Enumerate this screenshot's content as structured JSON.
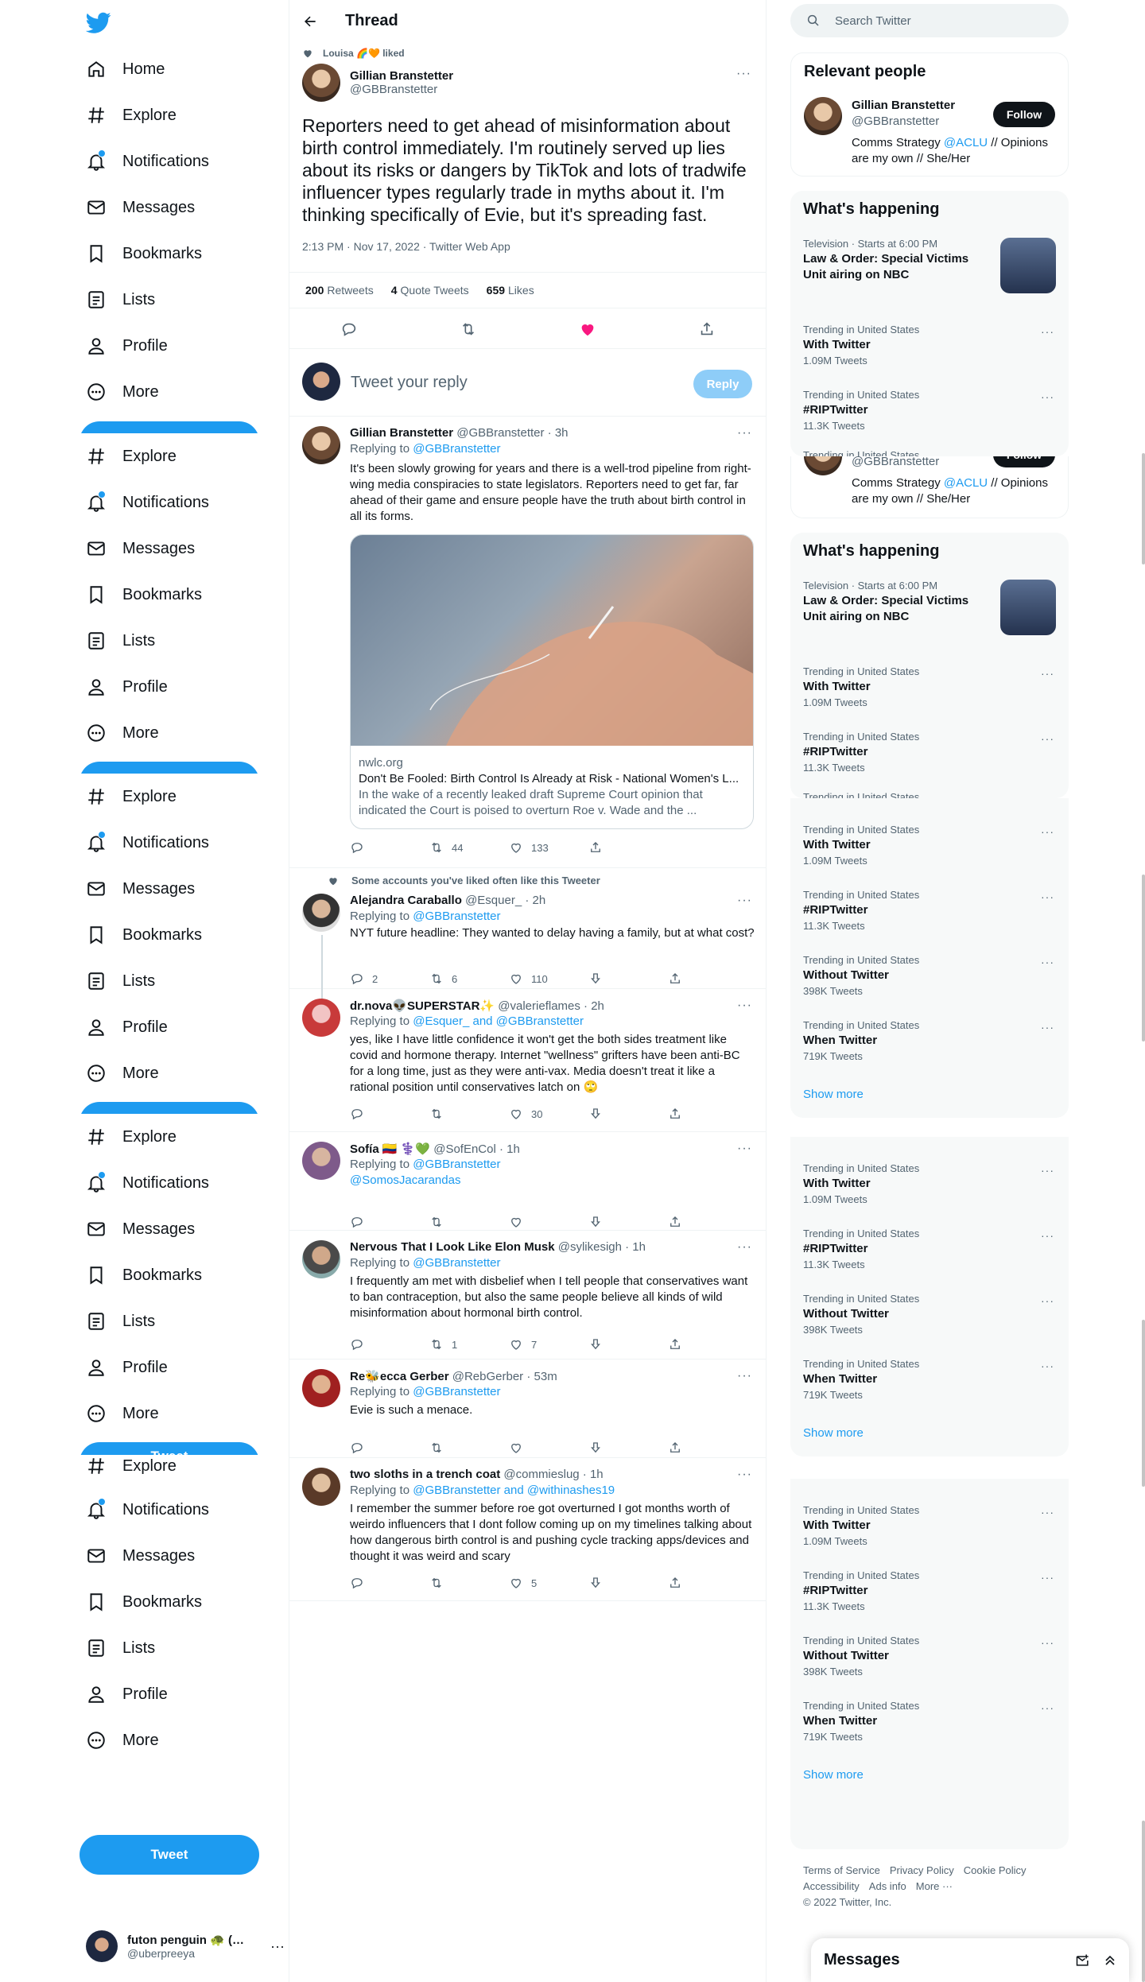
{
  "nav": {
    "items": [
      {
        "label": "Home"
      },
      {
        "label": "Explore"
      },
      {
        "label": "Notifications"
      },
      {
        "label": "Messages"
      },
      {
        "label": "Bookmarks"
      },
      {
        "label": "Lists"
      },
      {
        "label": "Profile"
      },
      {
        "label": "More"
      }
    ],
    "tweet_label": "Tweet",
    "account": {
      "name": "futon penguin 🐢 (…",
      "handle": "@uberpreeya"
    }
  },
  "thread": {
    "title": "Thread",
    "liked_by": "Louisa 🌈🧡 liked",
    "author": {
      "name": "Gillian Branstetter",
      "handle": "@GBBranstetter"
    },
    "text": "Reporters need to get ahead of misinformation about birth control immediately. I'm routinely served up lies about its risks or dangers by TikTok and lots of tradwife influencer types regularly trade in myths about it. I'm thinking specifically of Evie, but it's spreading fast.",
    "meta": "2:13 PM · Nov 17, 2022 · Twitter Web App",
    "stats": {
      "retweets": "200",
      "retweets_label": "Retweets",
      "quotes": "4",
      "quotes_label": "Quote Tweets",
      "likes": "659",
      "likes_label": "Likes"
    },
    "reply_placeholder": "Tweet your reply",
    "reply_button": "Reply"
  },
  "replies": [
    {
      "name": "Gillian Branstetter",
      "handle": "@GBBranstetter · 3h",
      "replying": "Replying to",
      "to": "@GBBranstetter",
      "text": "It's been slowly growing for years and there is a well-trod pipeline from right-wing media conspiracies to state legislators. Reporters need to get far, far ahead of their game and ensure people have the truth about birth control in all its forms.",
      "card": {
        "domain": "nwlc.org",
        "title": "Don't Be Fooled: Birth Control Is Already at Risk - National Women's L...",
        "desc": "In the wake of a recently leaked draft Supreme Court opinion that indicated the Court is poised to overturn Roe v. Wade and the ..."
      },
      "retweets": "44",
      "likes": "133"
    },
    {
      "context": "Some accounts you've liked often like this Tweeter",
      "name": "Alejandra Caraballo",
      "handle": "@Esquer_ · 2h",
      "replying": "Replying to",
      "to": "@GBBranstetter",
      "text": "NYT future headline: They wanted to delay having a family, but at what cost?",
      "replies": "2",
      "retweets": "6",
      "likes": "110"
    },
    {
      "name": "dr.nova👽SUPERSTAR✨",
      "handle": "@valerieflames · 2h",
      "replying": "Replying to",
      "to": "@Esquer_ and @GBBranstetter",
      "text": "yes, like I have little confidence it won't get the both sides treatment like covid and hormone therapy. Internet \"wellness\" grifters have been anti-BC for a long time, just as they were anti-vax. Media doesn't treat it like a rational position until conservatives latch on 🙄",
      "likes": "30"
    },
    {
      "name": "Sofía 🇨🇴 ⚕️💚",
      "handle": "@SofEnCol · 1h",
      "replying": "Replying to",
      "to": "@GBBranstetter",
      "to2": "@SomosJacarandas"
    },
    {
      "name": "Nervous That I Look Like Elon Musk",
      "handle": "@sylikesigh · 1h",
      "replying": "Replying to",
      "to": "@GBBranstetter",
      "text": "I frequently am met with disbelief when I tell people that conservatives want to ban contraception, but also the same people believe all kinds of wild misinformation about hormonal birth control.",
      "retweets": "1",
      "likes": "7"
    },
    {
      "name": "Re🐝ecca Gerber",
      "handle": "@RebGerber · 53m",
      "replying": "Replying to",
      "to": "@GBBranstetter",
      "text": "Evie is such a menace."
    },
    {
      "name": "two sloths in a trench coat",
      "handle": "@commieslug · 1h",
      "replying": "Replying to",
      "to": "@GBBranstetter and @withinashes19",
      "text": "I remember the summer before roe got overturned I got months worth of weirdo influencers that I dont follow coming up on my timelines talking about how dangerous birth control is and pushing cycle tracking apps/devices and thought it was weird and scary",
      "likes": "5"
    }
  ],
  "sidebar": {
    "search_placeholder": "Search Twitter",
    "relevant_title": "Relevant people",
    "person": {
      "name": "Gillian Branstetter",
      "handle": "@GBBranstetter",
      "follow": "Follow",
      "bio_a": "Comms Strategy ",
      "bio_link": "@ACLU",
      "bio_b": " // Opinions are my own // She/Her"
    },
    "happening_title": "What's happening",
    "trends": [
      {
        "cat": "Television · Starts at 6:00 PM",
        "name": "Law & Order: Special Victims Unit airing on NBC",
        "vol": ""
      },
      {
        "cat": "Trending in United States",
        "name": "With Twitter",
        "vol": "1.09M Tweets"
      },
      {
        "cat": "Trending in United States",
        "name": "#RIPTwitter",
        "vol": "11.3K Tweets"
      },
      {
        "cat": "Trending in United States",
        "name": "Without Twitter",
        "vol": "398K Tweets"
      },
      {
        "cat": "Trending in United States",
        "name": "When Twitter",
        "vol": "719K Tweets"
      }
    ],
    "show_more": "Show more",
    "footer": [
      "Terms of Service",
      "Privacy Policy",
      "Cookie Policy",
      "Accessibility",
      "Ads info",
      "More ···",
      "© 2022 Twitter, Inc."
    ],
    "messages": "Messages"
  }
}
